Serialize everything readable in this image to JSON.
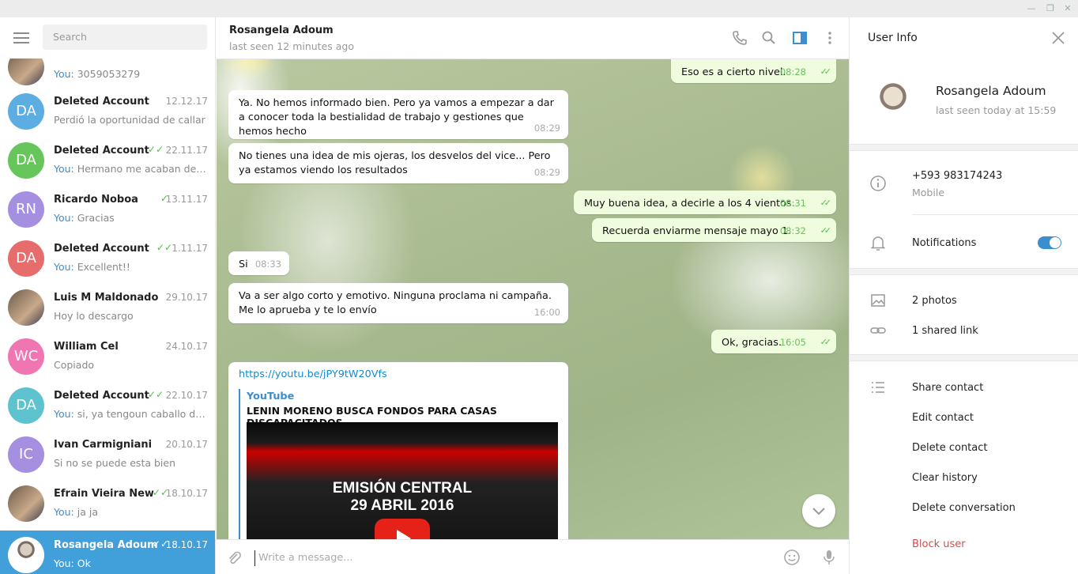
{
  "sidebar": {
    "search_placeholder": "Search",
    "chats": [
      {
        "name": "",
        "date": "",
        "you": "You: ",
        "preview": "3059053279",
        "initials": "",
        "color": "",
        "checks": false
      },
      {
        "name": "Deleted Account",
        "date": "12.12.17",
        "you": "",
        "preview": "Perdió la oportunidad de callar",
        "initials": "DA",
        "color": "#5caee2",
        "checks": false
      },
      {
        "name": "Deleted Account",
        "date": "22.11.17",
        "you": "You: ",
        "preview": "Hermano me acaban de ll...",
        "initials": "DA",
        "color": "#66c65b",
        "checks": true
      },
      {
        "name": "Ricardo Noboa",
        "date": "13.11.17",
        "you": "You: ",
        "preview": "Gracias",
        "initials": "RN",
        "color": "#a48fe0",
        "checks": true
      },
      {
        "name": "Deleted Account",
        "date": "1.11.17",
        "you": "You: ",
        "preview": "Excellent!!",
        "initials": "DA",
        "color": "#e76d6d",
        "checks": true
      },
      {
        "name": "Luis M Maldonado",
        "date": "29.10.17",
        "you": "",
        "preview": "Hoy lo descargo",
        "initials": "",
        "color": "",
        "checks": false
      },
      {
        "name": "William Cel",
        "date": "24.10.17",
        "you": "",
        "preview": "Copiado",
        "initials": "WC",
        "color": "#ef76b0",
        "checks": false
      },
      {
        "name": "Deleted Account",
        "date": "22.10.17",
        "you": "You: ",
        "preview": "si, ya tengoun caballo de t...",
        "initials": "DA",
        "color": "#5ec3cf",
        "checks": true
      },
      {
        "name": "Ivan Carmigniani",
        "date": "20.10.17",
        "you": "",
        "preview": "Si no se puede esta bien",
        "initials": "IC",
        "color": "#a48fe0",
        "checks": false
      },
      {
        "name": "Efrain Vieira New",
        "date": "18.10.17",
        "you": "You: ",
        "preview": "ja ja",
        "initials": "",
        "color": "",
        "checks": true
      },
      {
        "name": "Rosangela Adoum",
        "date": "18.10.17",
        "you": "You: ",
        "preview": "Ok",
        "initials": "",
        "color": "",
        "checks": true
      }
    ]
  },
  "chat": {
    "title": "Rosangela Adoum",
    "status": "last seen 12 minutes ago",
    "messages": [
      {
        "text": "Eso es a cierto nivel.",
        "time": "08:28"
      },
      {
        "text": "Ya. No hemos informado bien. Pero ya vamos a empezar a dar a conocer toda la bestialidad de trabajo y gestiones que hemos hecho",
        "time": "08:29"
      },
      {
        "text": "No tienes una idea de mis ojeras, los desvelos del vice... Pero ya estamos viendo los resultados",
        "time": "08:29"
      },
      {
        "text": "Muy buena idea, a decirle a los 4 vientos.",
        "time": "08:31"
      },
      {
        "text": "Recuerda enviarme mensaje mayo 1.",
        "time": "08:32"
      },
      {
        "text": "Si",
        "time": "08:33"
      },
      {
        "text": "Va a ser algo corto y emotivo. Ninguna proclama ni campaña. Me lo aprueba y te lo envío",
        "time": "16:00"
      },
      {
        "text": "Ok, gracias.",
        "time": "16:05"
      }
    ],
    "link": {
      "url": "https://youtu.be/jPY9tW20Vfs",
      "site": "YouTube",
      "title": "LENIN MORENO BUSCA FONDOS PARA CASAS DISCAPACITADOS",
      "video_line1": "EMISIÓN CENTRAL",
      "video_line2": "29 ABRIL 2016"
    },
    "composer_placeholder": "Write a message..."
  },
  "info": {
    "title": "User Info",
    "name": "Rosangela Adoum",
    "seen": "last seen today at 15:59",
    "phone": "+593 983174243",
    "phone_label": "Mobile",
    "notifications": "Notifications",
    "notifications_on": true,
    "photos": "2 photos",
    "links": "1 shared link",
    "actions": [
      "Share contact",
      "Edit contact",
      "Delete contact",
      "Clear history",
      "Delete conversation"
    ],
    "block": "Block user"
  }
}
